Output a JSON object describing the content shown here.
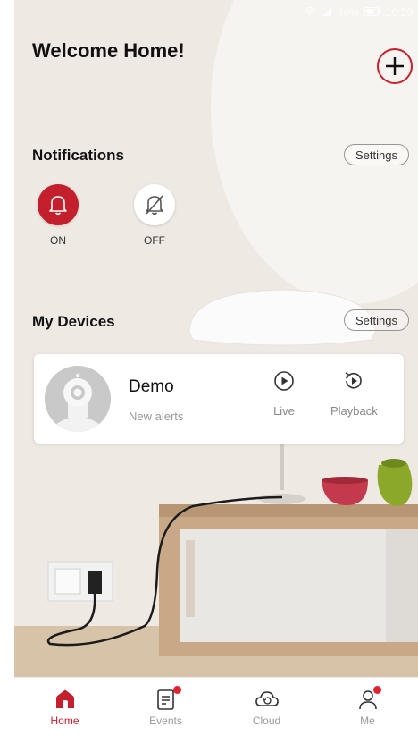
{
  "status_bar": {
    "battery": "60%",
    "time": "10:29"
  },
  "header": {
    "title": "Welcome Home!",
    "add_icon": "plus-icon"
  },
  "notifications": {
    "title": "Notifications",
    "settings_label": "Settings",
    "on_label": "ON",
    "off_label": "OFF",
    "on_icon": "bell-icon",
    "off_icon": "bell-off-icon"
  },
  "devices": {
    "title": "My Devices",
    "settings_label": "Settings",
    "items": [
      {
        "name": "Demo",
        "status": "New alerts",
        "live_label": "Live",
        "playback_label": "Playback"
      }
    ]
  },
  "tabbar": {
    "items": [
      {
        "label": "Home",
        "icon": "home-icon"
      },
      {
        "label": "Events",
        "icon": "events-icon"
      },
      {
        "label": "Cloud",
        "icon": "cloud-icon"
      },
      {
        "label": "Me",
        "icon": "person-icon"
      }
    ]
  },
  "colors": {
    "accent": "#c41f2d",
    "badge": "#e02233"
  }
}
